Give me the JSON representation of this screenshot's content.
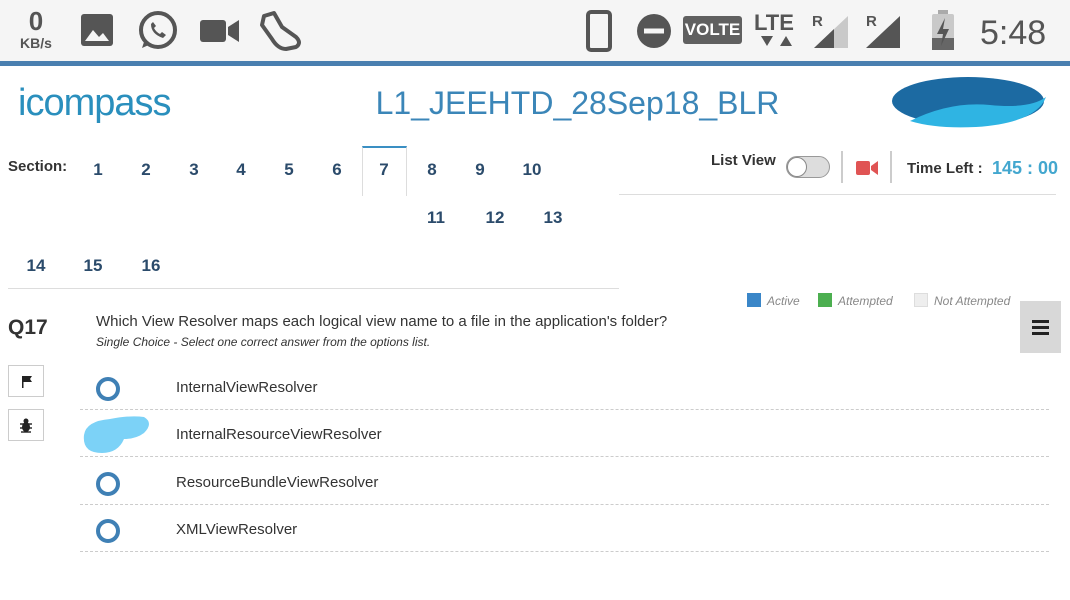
{
  "status_bar": {
    "speed_value": "0",
    "speed_unit": "KB/s",
    "volte": "VOLTE",
    "lte": "LTE",
    "roaming_1": "R",
    "roaming_2": "R",
    "time": "5:48",
    "icons": [
      "image-icon",
      "whatsapp-icon",
      "video-camera-icon",
      "shoe-icon",
      "phone-icon",
      "do-not-disturb-icon",
      "signal-icon",
      "signal-icon",
      "battery-charging-icon"
    ]
  },
  "header": {
    "logo_text": "icompass",
    "exam_title": "L1_JEEHTD_28Sep18_BLR"
  },
  "sections": {
    "label": "Section:",
    "items": [
      "1",
      "2",
      "3",
      "4",
      "5",
      "6",
      "7",
      "8",
      "9",
      "10",
      "11",
      "12",
      "13",
      "14",
      "15",
      "16"
    ],
    "active": "7"
  },
  "controls": {
    "list_view_label": "List View",
    "list_view_on": false,
    "time_left_label": "Time Left :",
    "time_left_value": "145 : 00"
  },
  "legend": {
    "active": "Active",
    "attempted": "Attempted",
    "not_attempted": "Not Attempted",
    "colors": {
      "active": "#3a86c8",
      "attempted": "#4caf50",
      "not_attempted": "#eeeeee"
    }
  },
  "question": {
    "number": "Q17",
    "text": "Which View Resolver maps each logical view name to a file in the application's folder?",
    "subtext": "Single Choice - Select one correct answer from the options list.",
    "options": [
      "InternalViewResolver",
      "InternalResourceViewResolver",
      "ResourceBundleViewResolver",
      "XMLViewResolver"
    ]
  },
  "colors": {
    "accent": "#3b86b8",
    "timer": "#43a7cf",
    "radio": "#3f80b5",
    "camera": "#e05454"
  }
}
